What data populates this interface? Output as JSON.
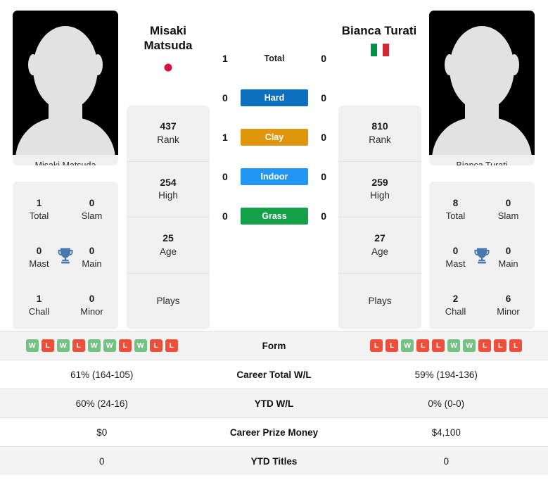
{
  "players": {
    "left": {
      "name": "Misaki Matsuda",
      "name_line1": "Misaki",
      "name_line2": "Matsuda",
      "photo_caption": "Misaki Matsuda",
      "flag": "jp-flag-icon",
      "flag_colors": [
        "#ffffff",
        "#d4103f"
      ],
      "titles": {
        "total": "1",
        "total_label": "Total",
        "slam": "0",
        "slam_label": "Slam",
        "mast": "0",
        "mast_label": "Mast",
        "main": "0",
        "main_label": "Main",
        "chall": "1",
        "chall_label": "Chall",
        "minor": "0",
        "minor_label": "Minor"
      },
      "info": {
        "rank": "437",
        "rank_label": "Rank",
        "high": "254",
        "high_label": "High",
        "age": "25",
        "age_label": "Age",
        "plays": "",
        "plays_label": "Plays"
      },
      "form": [
        "W",
        "L",
        "W",
        "L",
        "W",
        "W",
        "L",
        "W",
        "L",
        "L"
      ],
      "career_wl": "61% (164-105)",
      "ytd_wl": "60% (24-16)",
      "career_prize": "$0",
      "ytd_titles": "0"
    },
    "right": {
      "name": "Bianca Turati",
      "name_line1": "Bianca Turati",
      "name_line2": "",
      "photo_caption": "Bianca Turati",
      "flag": "it-flag-icon",
      "flag_colors": [
        "#009246",
        "#ffffff",
        "#ce2b37"
      ],
      "titles": {
        "total": "8",
        "total_label": "Total",
        "slam": "0",
        "slam_label": "Slam",
        "mast": "0",
        "mast_label": "Mast",
        "main": "0",
        "main_label": "Main",
        "chall": "2",
        "chall_label": "Chall",
        "minor": "6",
        "minor_label": "Minor"
      },
      "info": {
        "rank": "810",
        "rank_label": "Rank",
        "high": "259",
        "high_label": "High",
        "age": "27",
        "age_label": "Age",
        "plays": "",
        "plays_label": "Plays"
      },
      "form": [
        "L",
        "L",
        "W",
        "L",
        "L",
        "W",
        "W",
        "L",
        "L",
        "L"
      ],
      "career_wl": "59% (194-136)",
      "ytd_wl": "0% (0-0)",
      "career_prize": "$4,100",
      "ytd_titles": "0"
    }
  },
  "h2h": {
    "rows": [
      {
        "label": "Total",
        "left": "1",
        "right": "0",
        "color": "",
        "text_color": "#1c1c1c"
      },
      {
        "label": "Hard",
        "left": "0",
        "right": "0",
        "color": "#0d6fc0",
        "text_color": "#ffffff"
      },
      {
        "label": "Clay",
        "left": "1",
        "right": "0",
        "color": "#e0960c",
        "text_color": "#ffffff"
      },
      {
        "label": "Indoor",
        "left": "0",
        "right": "0",
        "color": "#2196f3",
        "text_color": "#ffffff"
      },
      {
        "label": "Grass",
        "left": "0",
        "right": "0",
        "color": "#13a049",
        "text_color": "#ffffff"
      }
    ]
  },
  "stats_table": {
    "rows": [
      {
        "label": "Form",
        "type": "form",
        "left": "",
        "right": ""
      },
      {
        "label": "Career Total W/L",
        "type": "text",
        "left": "61% (164-105)",
        "right": "59% (194-136)"
      },
      {
        "label": "YTD W/L",
        "type": "text",
        "left": "60% (24-16)",
        "right": "0% (0-0)"
      },
      {
        "label": "Career Prize Money",
        "type": "text",
        "left": "$0",
        "right": "$4,100"
      },
      {
        "label": "YTD Titles",
        "type": "text",
        "left": "0",
        "right": "0"
      }
    ]
  },
  "icons": {
    "trophy": "trophy-icon",
    "trophy_color": "#4878b0"
  }
}
